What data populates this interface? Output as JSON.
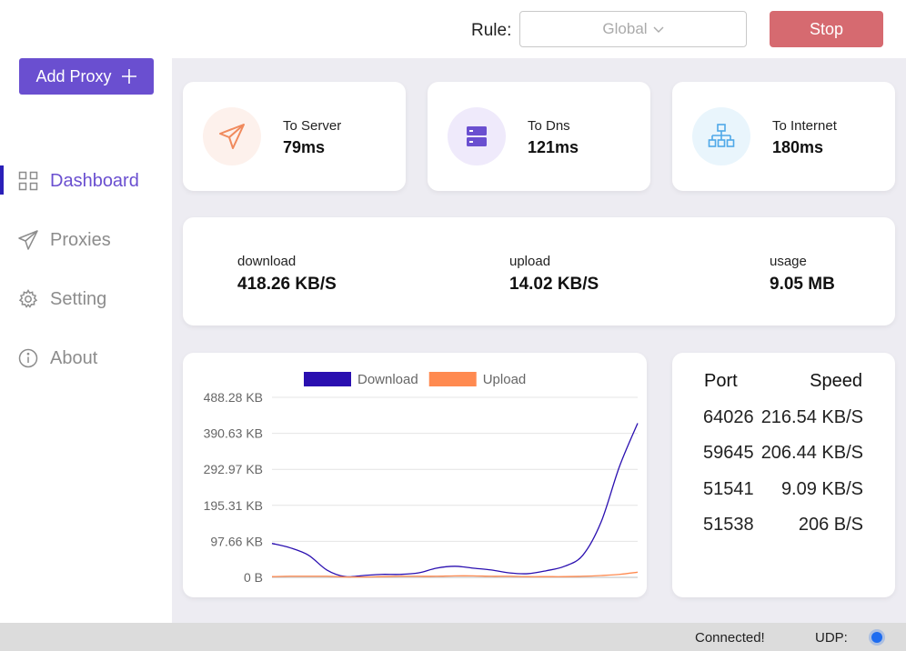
{
  "header": {
    "rule_label": "Rule:",
    "rule_value": "Global",
    "stop_label": "Stop"
  },
  "sidebar": {
    "add_proxy_label": "Add Proxy",
    "items": [
      {
        "label": "Dashboard",
        "icon": "grid-icon",
        "active": true
      },
      {
        "label": "Proxies",
        "icon": "send-icon",
        "active": false
      },
      {
        "label": "Setting",
        "icon": "gear-icon",
        "active": false
      },
      {
        "label": "About",
        "icon": "info-icon",
        "active": false
      }
    ]
  },
  "latency": [
    {
      "label": "To Server",
      "value": "79ms",
      "icon": "paper-plane-icon",
      "color": "#f08a5d"
    },
    {
      "label": "To Dns",
      "value": "121ms",
      "icon": "server-icon",
      "color": "#6a4fd0"
    },
    {
      "label": "To Internet",
      "value": "180ms",
      "icon": "network-icon",
      "color": "#4fa8e8"
    }
  ],
  "traffic": {
    "download_label": "download",
    "download_value": "418.26 KB/S",
    "upload_label": "upload",
    "upload_value": "14.02 KB/S",
    "usage_label": "usage",
    "usage_value": "9.05 MB"
  },
  "chart_data": {
    "type": "line",
    "x": [
      0,
      1,
      2,
      3,
      4,
      5,
      6,
      7,
      8,
      9,
      10,
      11,
      12,
      13,
      14,
      15,
      16,
      17,
      18,
      19,
      20
    ],
    "series": [
      {
        "name": "Download",
        "color": "#2a0fb0",
        "values": [
          92,
          80,
          60,
          20,
          2,
          5,
          8,
          8,
          12,
          25,
          30,
          25,
          20,
          12,
          10,
          18,
          30,
          60,
          150,
          300,
          418
        ]
      },
      {
        "name": "Upload",
        "color": "#ff8a50",
        "values": [
          2,
          3,
          3,
          3,
          1,
          1,
          2,
          3,
          3,
          3,
          4,
          4,
          3,
          3,
          2,
          2,
          2,
          3,
          5,
          8,
          14
        ]
      }
    ],
    "ylim": [
      0,
      488.28
    ],
    "yticks": [
      0,
      97.66,
      195.31,
      292.97,
      390.63,
      488.28
    ],
    "ytick_labels": [
      "0 B",
      "97.66 KB",
      "195.31 KB",
      "292.97 KB",
      "390.63 KB",
      "488.28 KB"
    ],
    "legend": "top-center",
    "grid": true
  },
  "ports": {
    "port_header": "Port",
    "speed_header": "Speed",
    "rows": [
      {
        "port": "64026",
        "speed": "216.54 KB/S"
      },
      {
        "port": "59645",
        "speed": "206.44 KB/S"
      },
      {
        "port": "51541",
        "speed": "9.09 KB/S"
      },
      {
        "port": "51538",
        "speed": "206 B/S"
      }
    ]
  },
  "status": {
    "connection": "Connected!",
    "udp_label": "UDP:",
    "udp_color": "#1e6cf0"
  }
}
